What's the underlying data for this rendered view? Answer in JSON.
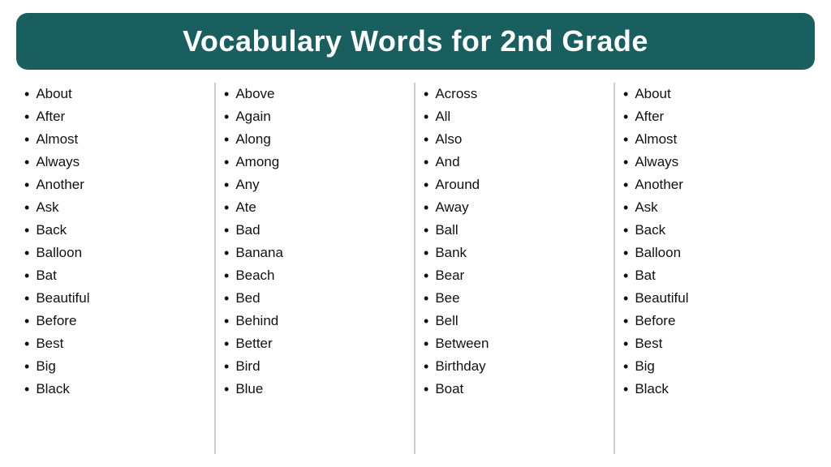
{
  "title": "Vocabulary Words for 2nd Grade",
  "columns": [
    {
      "id": "col1",
      "words": [
        "About",
        "After",
        "Almost",
        "Always",
        "Another",
        "Ask",
        "Back",
        "Balloon",
        "Bat",
        "Beautiful",
        "Before",
        "Best",
        "Big",
        "Black"
      ]
    },
    {
      "id": "col2",
      "words": [
        "Above",
        "Again",
        "Along",
        "Among",
        "Any",
        "Ate",
        "Bad",
        "Banana",
        "Beach",
        "Bed",
        "Behind",
        "Better",
        "Bird",
        "Blue"
      ]
    },
    {
      "id": "col3",
      "words": [
        "Across",
        "All",
        "Also",
        "And",
        "Around",
        "Away",
        "Ball",
        "Bank",
        "Bear",
        "Bee",
        "Bell",
        "Between",
        "Birthday",
        "Boat"
      ]
    },
    {
      "id": "col4",
      "words": [
        "About",
        "After",
        "Almost",
        "Always",
        "Another",
        "Ask",
        "Back",
        "Balloon",
        "Bat",
        "Beautiful",
        "Before",
        "Best",
        "Big",
        "Black"
      ]
    }
  ]
}
